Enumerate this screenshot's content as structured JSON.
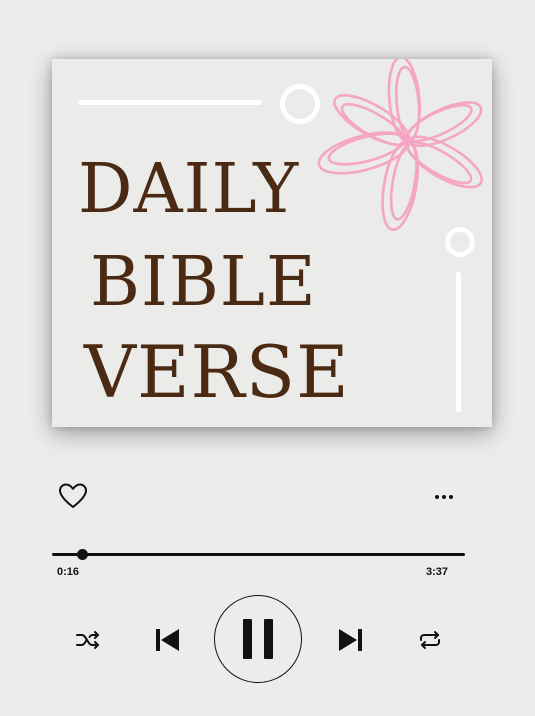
{
  "album": {
    "title_lines": [
      "DAILY",
      "BIBLE",
      "VERSE"
    ],
    "accent_color": "#f4a6c4",
    "text_color": "#4a2a12"
  },
  "actions": {
    "like_icon": "heart-outline-icon",
    "more_icon": "more-horizontal-icon"
  },
  "player": {
    "elapsed": "0:16",
    "total": "3:37",
    "progress_fraction": 0.074,
    "state": "playing"
  },
  "controls": {
    "shuffle_icon": "shuffle-icon",
    "previous_icon": "skip-previous-icon",
    "pause_icon": "pause-icon",
    "next_icon": "skip-next-icon",
    "repeat_icon": "repeat-icon"
  }
}
